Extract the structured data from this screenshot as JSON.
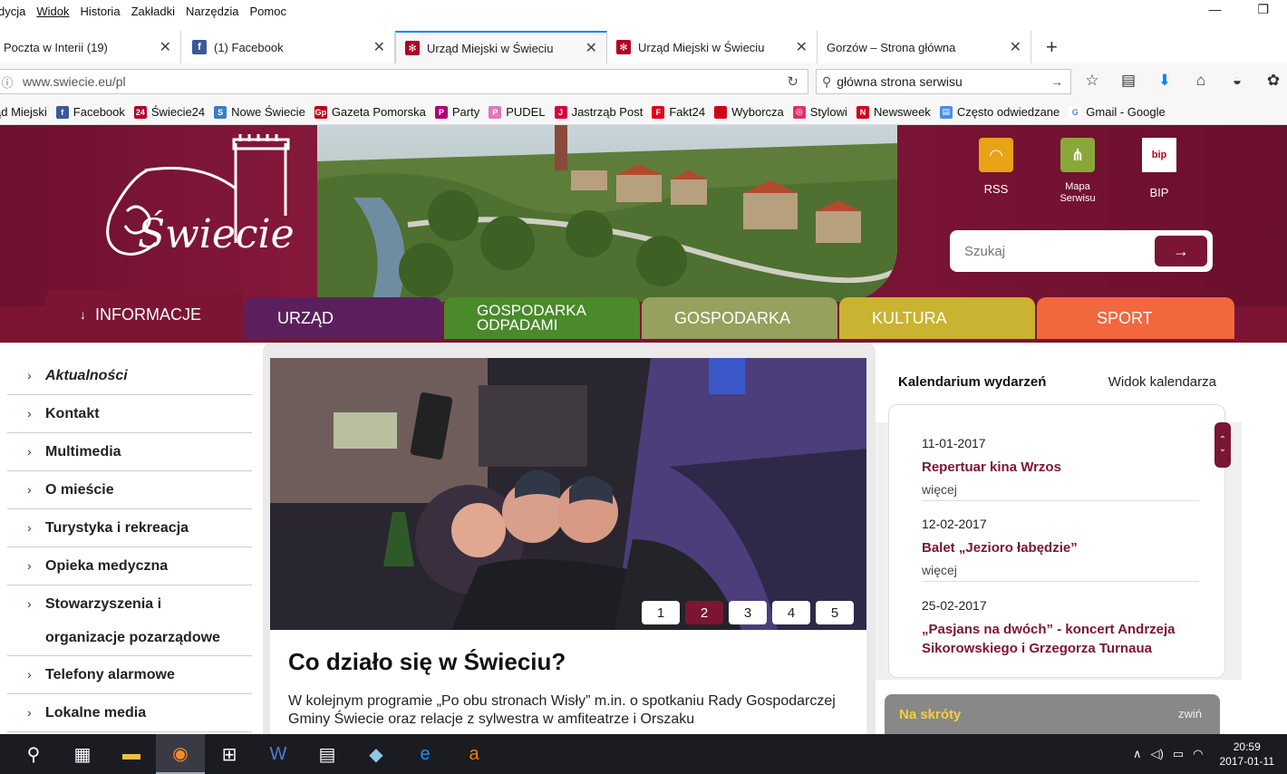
{
  "menubar": {
    "items": [
      "dycja",
      "Widok",
      "Historia",
      "Zakładki",
      "Narzędzia",
      "Pomoc"
    ],
    "minimize": "—",
    "restore": "❐"
  },
  "tabs": [
    {
      "label": "Poczta w Interii (19)",
      "icon": "mail-icon"
    },
    {
      "label": "(1) Facebook",
      "icon": "facebook-icon"
    },
    {
      "label": "Urząd Miejski w Świeciu",
      "icon": "swiecie-icon",
      "active": true
    },
    {
      "label": "Urząd Miejski w Świeciu",
      "icon": "swiecie-icon"
    },
    {
      "label": "Gorzów – Strona główna",
      "icon": "none"
    }
  ],
  "navbar": {
    "url": "www.swiecie.eu/pl",
    "search_value": "główna strona serwisu"
  },
  "bookmarks": [
    {
      "label": "ąd Miejski",
      "color": ""
    },
    {
      "label": "Facebook",
      "color": "#3b5998",
      "glyph": "f"
    },
    {
      "label": "Świecie24",
      "color": "#b1002a",
      "glyph": "24"
    },
    {
      "label": "Nowe Świecie",
      "color": "#3a7fc4",
      "glyph": "S"
    },
    {
      "label": "Gazeta Pomorska",
      "color": "#c0001a",
      "glyph": "Gp"
    },
    {
      "label": "Party",
      "color": "#b0007a",
      "glyph": "P"
    },
    {
      "label": "PUDEL",
      "color": "#e277b8",
      "glyph": "P"
    },
    {
      "label": "Jastrząb Post",
      "color": "#d8003c",
      "glyph": "J"
    },
    {
      "label": "Fakt24",
      "color": "#e2001a",
      "glyph": "F"
    },
    {
      "label": "Wyborcza",
      "color": "#d0021b",
      "glyph": ""
    },
    {
      "label": "Stylowi",
      "color": "#e0306a",
      "glyph": "◎"
    },
    {
      "label": "Newsweek",
      "color": "#d0021b",
      "glyph": "N"
    },
    {
      "label": "Często odwiedzane",
      "color": "#4a8fe0",
      "glyph": "▤"
    },
    {
      "label": "Gmail - Google",
      "color": "#ffffff",
      "glyph": "G"
    }
  ],
  "site": {
    "logo_text": "Świecie",
    "quicklinks": [
      {
        "label": "RSS",
        "color": "#e8a316"
      },
      {
        "label": "Mapa Serwisu",
        "color": "#8aa83a"
      },
      {
        "label": "BIP",
        "color": "#ffffff"
      }
    ],
    "search_placeholder": "Szukaj"
  },
  "mainnav": [
    {
      "label": "INFORMACJE",
      "color": "#7b1533"
    },
    {
      "label": "URZĄD",
      "color": "#5b1f5e"
    },
    {
      "label": "GOSPODARKA ODPADAMI",
      "color": "#4a8a2a"
    },
    {
      "label": "GOSPODARKA",
      "color": "#97a05c"
    },
    {
      "label": "KULTURA",
      "color": "#c9b330"
    },
    {
      "label": "SPORT",
      "color": "#f2673e"
    }
  ],
  "sidebar": [
    "Aktualności",
    "Kontakt",
    "Multimedia",
    "O mieście",
    "Turystyka i rekreacja",
    "Opieka medyczna",
    "Stowarzyszenia i organizacje pozarządowe",
    "Telefony alarmowe",
    "Lokalne media"
  ],
  "slider": {
    "pages": [
      "1",
      "2",
      "3",
      "4",
      "5"
    ],
    "active": 2
  },
  "article": {
    "title": "Co działo się w Świeciu?",
    "excerpt": "W kolejnym programie „Po obu stronach Wisły” m.in. o spotkaniu Rady Gospodarczej Gminy Świecie oraz relacje z sylwestra w amfiteatrze i Orszaku"
  },
  "calendar": {
    "title": "Kalendarium wydarzeń",
    "switch": "Widok kalendarza",
    "events": [
      {
        "date": "11-01-2017",
        "title": "Repertuar kina Wrzos",
        "more": "więcej"
      },
      {
        "date": "12-02-2017",
        "title": "Balet „Jezioro łabędzie”",
        "more": "więcej"
      },
      {
        "date": "25-02-2017",
        "title": "„Pasjans na dwóch” - koncert Andrzeja Sikorowskiego i Grzegorza Turnaua",
        "more": ""
      }
    ]
  },
  "shortcuts": {
    "title": "Na skróty",
    "toggle": "zwiń"
  },
  "taskbar": {
    "time": "20:59",
    "date": "2017-01-11"
  }
}
